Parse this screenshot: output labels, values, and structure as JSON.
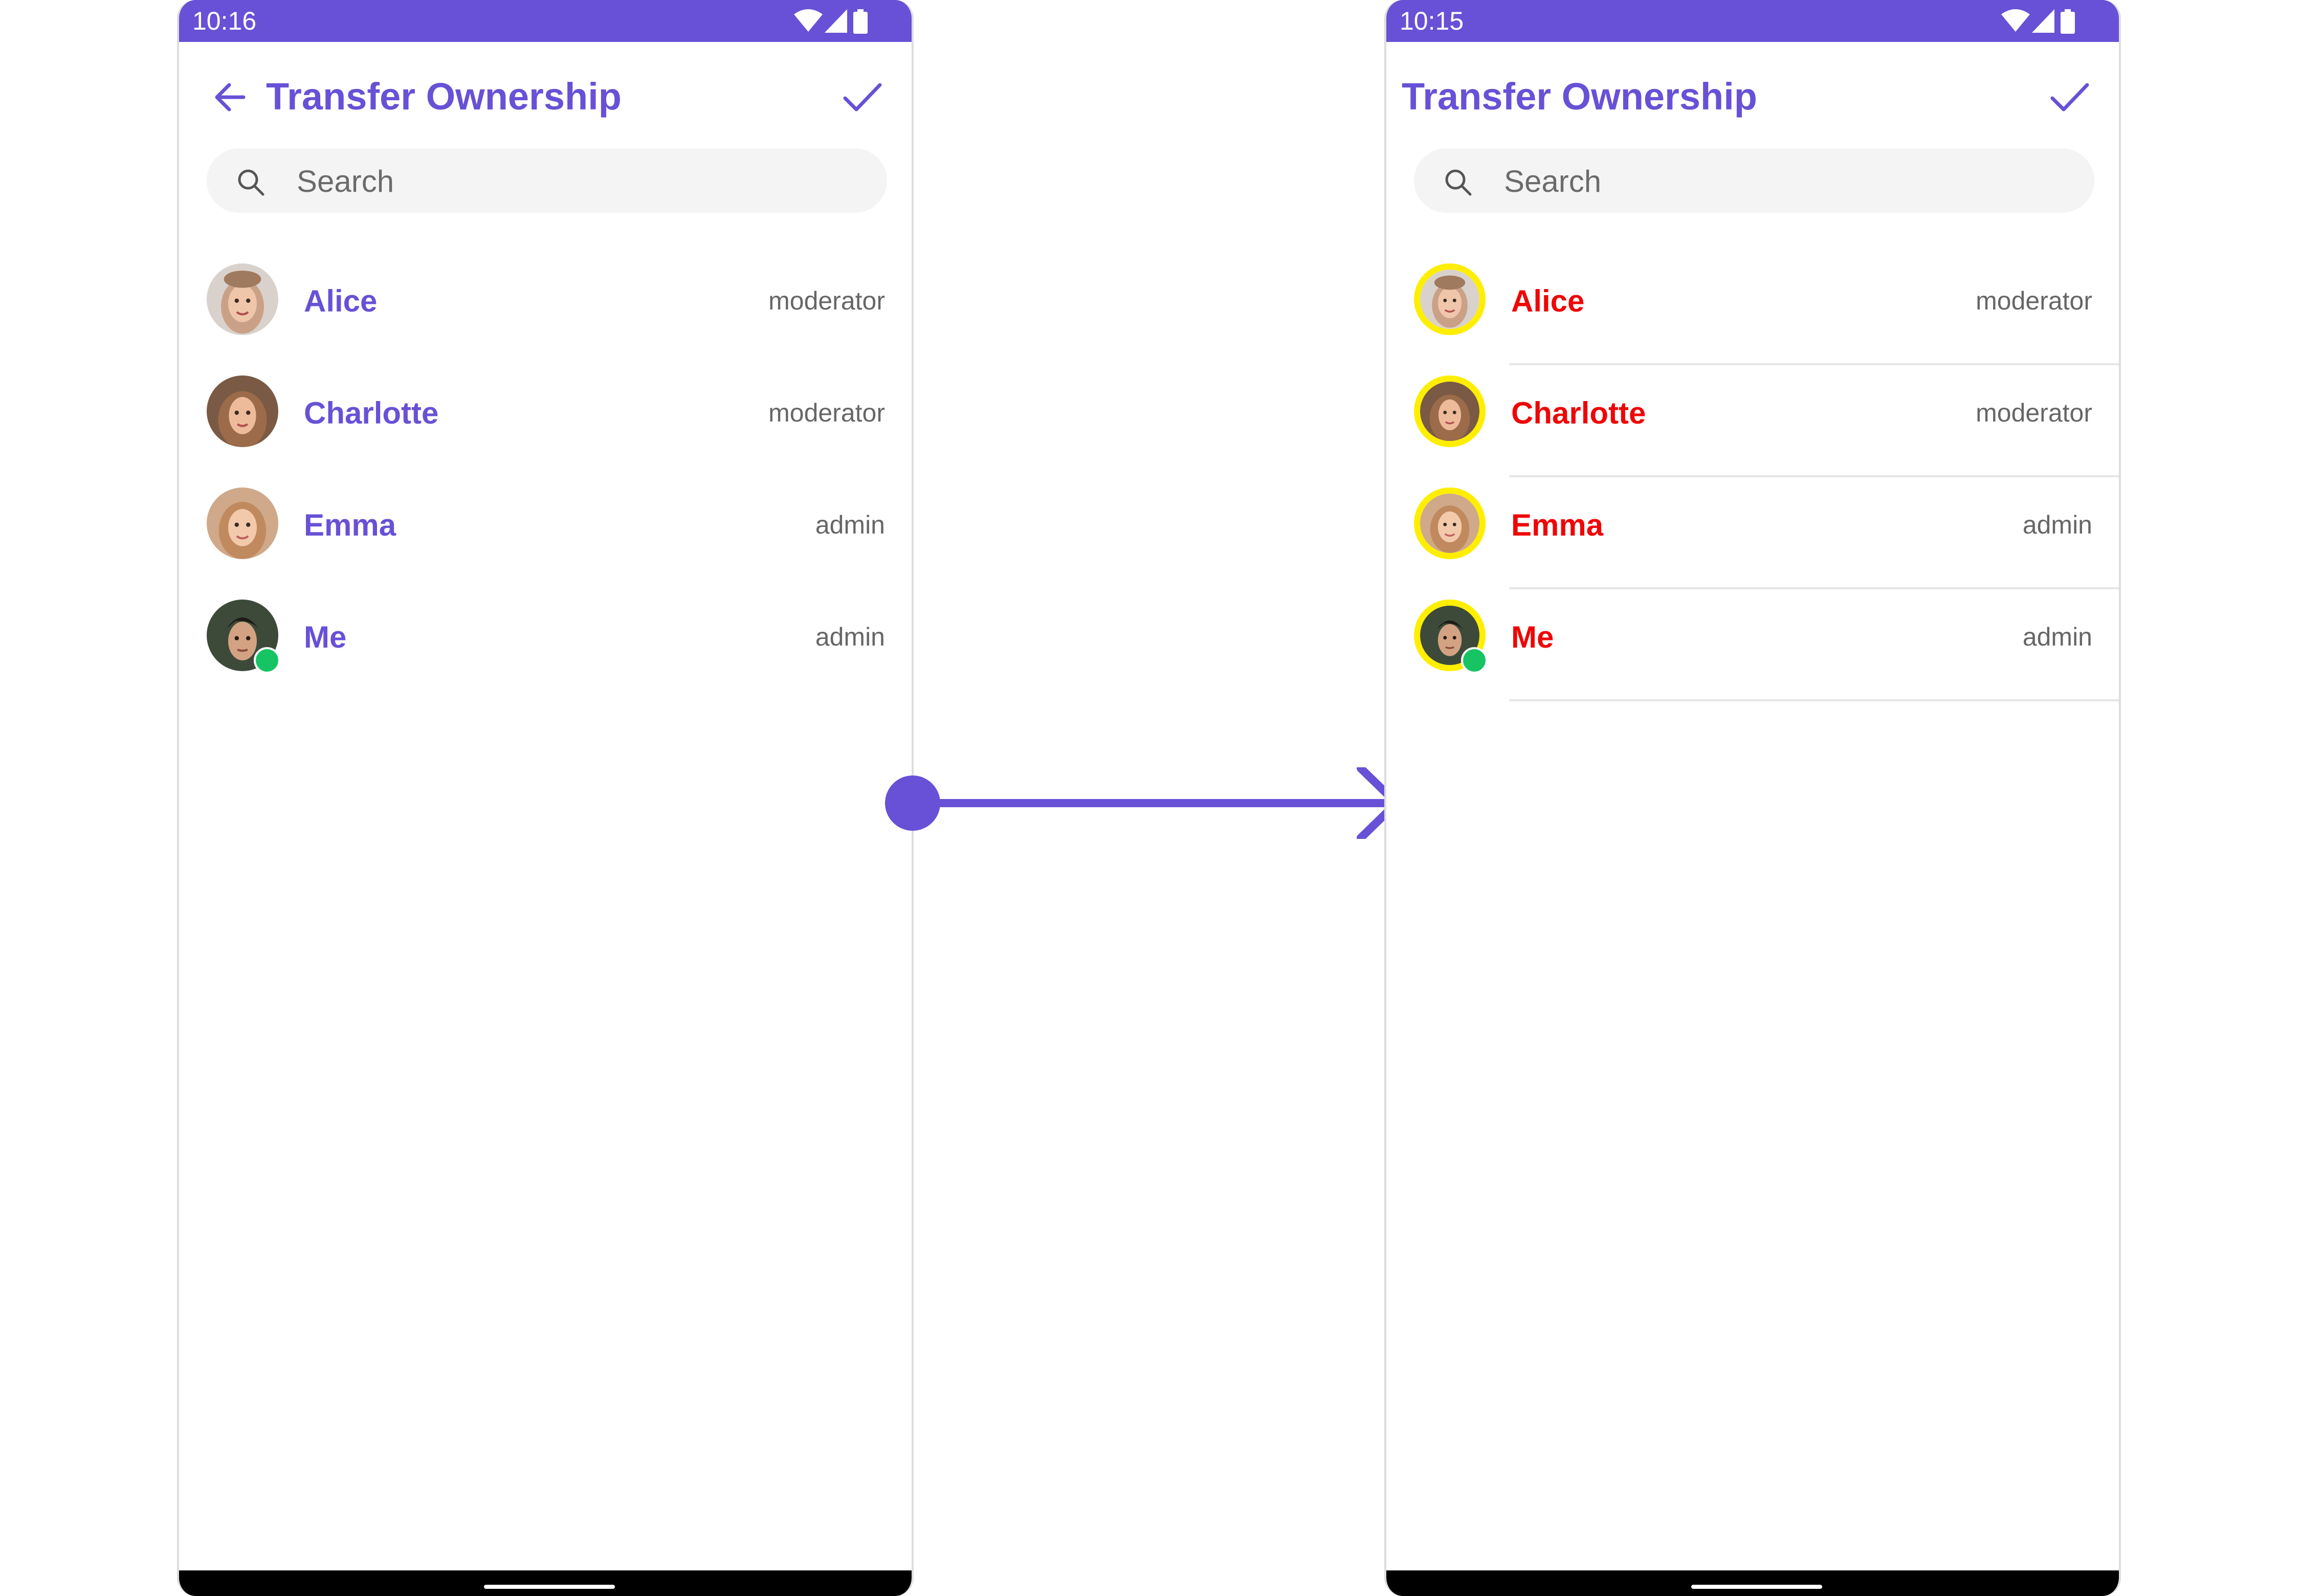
{
  "screens": {
    "left": {
      "status_time": "10:16",
      "title": "Transfer Ownership",
      "search_placeholder": "Search",
      "members": [
        {
          "name": "Alice",
          "role": "moderator",
          "online": false
        },
        {
          "name": "Charlotte",
          "role": "moderator",
          "online": false
        },
        {
          "name": "Emma",
          "role": "admin",
          "online": false
        },
        {
          "name": "Me",
          "role": "admin",
          "online": true
        }
      ]
    },
    "right": {
      "status_time": "10:15",
      "title": "Transfer Ownership",
      "search_placeholder": "Search",
      "members": [
        {
          "name": "Alice",
          "role": "moderator",
          "online": false
        },
        {
          "name": "Charlotte",
          "role": "moderator",
          "online": false
        },
        {
          "name": "Emma",
          "role": "admin",
          "online": false
        },
        {
          "name": "Me",
          "role": "admin",
          "online": true
        }
      ]
    }
  },
  "icons": {
    "back": "arrow-left-icon",
    "confirm": "check-icon",
    "search": "search-icon",
    "transition": "arrow-right-icon",
    "status": [
      "wifi-icon",
      "signal-icon",
      "battery-icon"
    ]
  },
  "colors": {
    "primary": "#6851d6",
    "custom_name": "#ef0606",
    "avatar_border": "#ffee00",
    "online": "#16c463",
    "role_text": "#666666",
    "search_bg": "#f4f4f4"
  }
}
